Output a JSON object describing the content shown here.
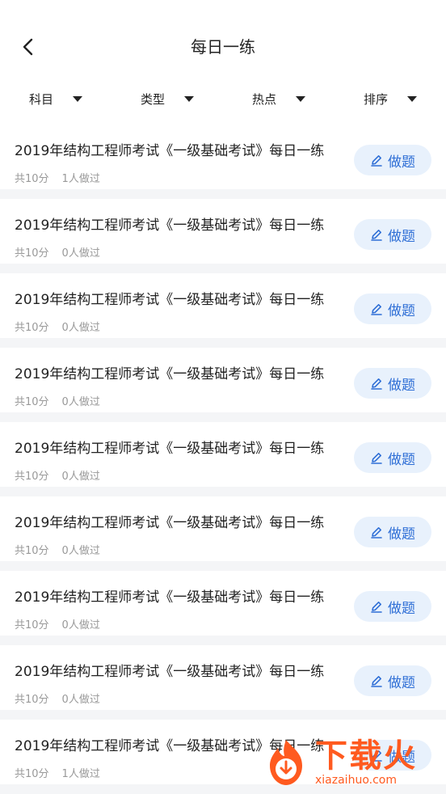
{
  "header": {
    "title": "每日一练"
  },
  "filters": [
    {
      "label": "科目"
    },
    {
      "label": "类型"
    },
    {
      "label": "热点"
    },
    {
      "label": "排序"
    }
  ],
  "items": [
    {
      "title": "2019年结构工程师考试《一级基础考试》每日一练",
      "score": "共10分",
      "done": "1人做过",
      "action": "做题"
    },
    {
      "title": "2019年结构工程师考试《一级基础考试》每日一练",
      "score": "共10分",
      "done": "0人做过",
      "action": "做题"
    },
    {
      "title": "2019年结构工程师考试《一级基础考试》每日一练",
      "score": "共10分",
      "done": "0人做过",
      "action": "做题"
    },
    {
      "title": "2019年结构工程师考试《一级基础考试》每日一练",
      "score": "共10分",
      "done": "0人做过",
      "action": "做题"
    },
    {
      "title": "2019年结构工程师考试《一级基础考试》每日一练",
      "score": "共10分",
      "done": "0人做过",
      "action": "做题"
    },
    {
      "title": "2019年结构工程师考试《一级基础考试》每日一练",
      "score": "共10分",
      "done": "0人做过",
      "action": "做题"
    },
    {
      "title": "2019年结构工程师考试《一级基础考试》每日一练",
      "score": "共10分",
      "done": "0人做过",
      "action": "做题"
    },
    {
      "title": "2019年结构工程师考试《一级基础考试》每日一练",
      "score": "共10分",
      "done": "0人做过",
      "action": "做题"
    },
    {
      "title": "2019年结构工程师考试《一级基础考试》每日一练",
      "score": "共10分",
      "done": "1人做过",
      "action": "做题"
    }
  ],
  "watermark": {
    "brand": "下载火",
    "site": "xiazaihuo.com"
  },
  "colors": {
    "accent": "#2f6fd6",
    "button_bg": "#e8f1fc",
    "watermark": "#ff5a1f"
  },
  "icons": {
    "back": "chevron-left-icon",
    "dropdown": "triangle-down-icon",
    "edit": "pencil-icon"
  }
}
